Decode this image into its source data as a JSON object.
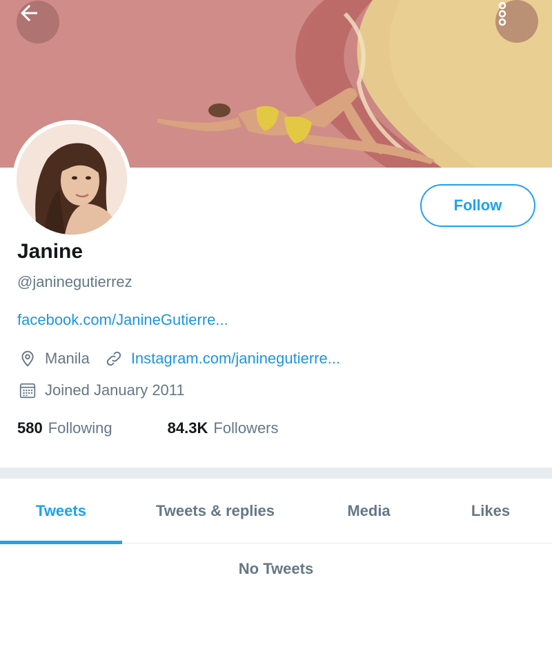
{
  "header": {
    "back_icon": "arrow-left-icon",
    "more_icon": "more-vertical-icon"
  },
  "profile": {
    "name": "Janine",
    "handle": "@janinegutierrez",
    "bio_link": "facebook.com/JanineGutierre...",
    "location": "Manila",
    "location_icon": "location-pin-icon",
    "website": "Instagram.com/janinegutierre...",
    "website_icon": "link-icon",
    "joined": "Joined January 2011",
    "joined_icon": "calendar-icon",
    "follow_label": "Follow"
  },
  "stats": {
    "following_count": "580",
    "following_label": "Following",
    "followers_count": "84.3K",
    "followers_label": "Followers"
  },
  "tabs": [
    {
      "label": "Tweets",
      "active": true
    },
    {
      "label": "Tweets & replies",
      "active": false
    },
    {
      "label": "Media",
      "active": false
    },
    {
      "label": "Likes",
      "active": false
    }
  ],
  "feed": {
    "empty_text": "No Tweets"
  },
  "colors": {
    "accent": "#1da1f2",
    "link": "#1b95e0",
    "secondary_text": "#657786",
    "primary_text": "#14171a",
    "divider": "#e6ecf0"
  }
}
